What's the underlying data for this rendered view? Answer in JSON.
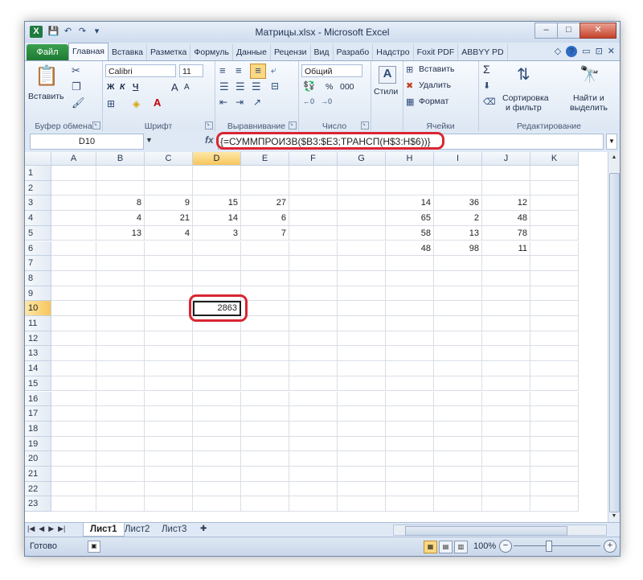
{
  "window": {
    "title": "Матрицы.xlsx - Microsoft Excel",
    "app_icon": "X",
    "buttons": {
      "minimize": "–",
      "maximize": "□",
      "close": "✕"
    }
  },
  "qat": {
    "save": "💾",
    "undo": "↶",
    "redo": "↷",
    "customize": "▾"
  },
  "ribbon_tabs": {
    "file": "Файл",
    "items": [
      "Главная",
      "Вставка",
      "Разметка",
      "Формуль",
      "Данные",
      "Рецензи",
      "Вид",
      "Разрабо",
      "Надстро",
      "Foxit PDF",
      "ABBYY PD"
    ],
    "active_index": 0,
    "right_icons": {
      "collapse": "◇",
      "help": "?",
      "min": "▭",
      "restore": "⊡",
      "close": "✕"
    }
  },
  "ribbon": {
    "clipboard": {
      "label": "Буфер обмена",
      "paste": "Вставить"
    },
    "font": {
      "label": "Шрифт",
      "name": "Calibri",
      "size": "11",
      "bold": "Ж",
      "italic": "К",
      "underline": "Ч",
      "grow": "A",
      "shrink": "A"
    },
    "alignment": {
      "label": "Выравнивание"
    },
    "number": {
      "label": "Число",
      "format": "Общий",
      "percent": "%",
      "thousands": "000"
    },
    "styles": {
      "label": "Стили"
    },
    "cells": {
      "label": "Ячейки",
      "insert": "Вставить",
      "delete": "Удалить",
      "format": "Формат"
    },
    "editing": {
      "label": "Редактирование",
      "sort": "Сортировка",
      "sort2": "и фильтр",
      "find": "Найти и",
      "find2": "выделить",
      "sigma": "Σ"
    }
  },
  "formula_bar": {
    "name_box": "D10",
    "fx": "fx",
    "formula": "{=СУММПРОИЗВ($B3:$E3;ТРАНСП(H$3:H$6))}"
  },
  "grid": {
    "columns": [
      "A",
      "B",
      "C",
      "D",
      "E",
      "F",
      "G",
      "H",
      "I",
      "J",
      "K"
    ],
    "selected_column": "D",
    "rows": [
      "1",
      "2",
      "3",
      "4",
      "5",
      "6",
      "7",
      "8",
      "9",
      "10",
      "11",
      "12",
      "13",
      "14",
      "15",
      "16",
      "17",
      "18",
      "19",
      "20",
      "21",
      "22",
      "23"
    ],
    "selected_row": "10",
    "cells": {
      "B3": "8",
      "C3": "9",
      "D3": "15",
      "E3": "27",
      "B4": "4",
      "C4": "21",
      "D4": "14",
      "E4": "6",
      "B5": "13",
      "C5": "4",
      "D5": "3",
      "E5": "7",
      "H3": "14",
      "I3": "36",
      "J3": "12",
      "H4": "65",
      "I4": "2",
      "J4": "48",
      "H5": "58",
      "I5": "13",
      "J5": "78",
      "H6": "48",
      "I6": "98",
      "J6": "11",
      "D10": "2863"
    },
    "active_cell": "D10"
  },
  "sheets": {
    "items": [
      "Лист1",
      "Лист2",
      "Лист3"
    ],
    "active": "Лист1"
  },
  "status": {
    "ready": "Готово",
    "zoom": "100%"
  }
}
